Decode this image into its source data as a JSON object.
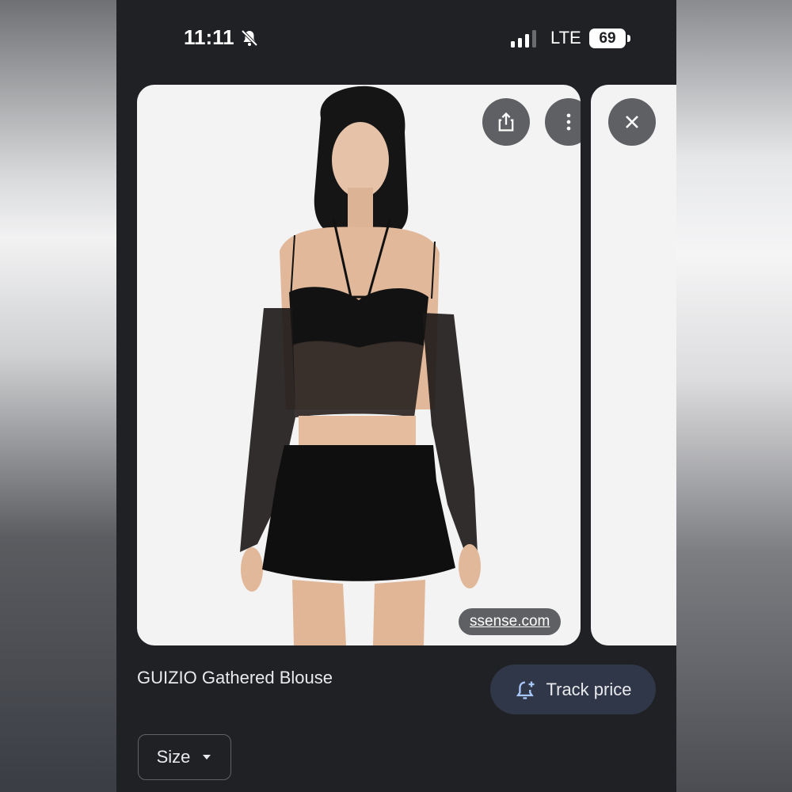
{
  "status_bar": {
    "time": "11:11",
    "network": "LTE",
    "battery": "69"
  },
  "product_image": {
    "alt": "Model wearing black sheer off-shoulder gathered blouse and mini skirt"
  },
  "source": {
    "label": "ssense.com"
  },
  "product": {
    "title": "GUIZIO Gathered Blouse"
  },
  "actions": {
    "track_price": "Track price",
    "size_label": "Size"
  },
  "icons": [
    "share-icon",
    "more-vert-icon",
    "close-icon",
    "bell-plus-icon",
    "dropdown-arrow-icon",
    "mute-bell-icon",
    "signal-icon"
  ]
}
